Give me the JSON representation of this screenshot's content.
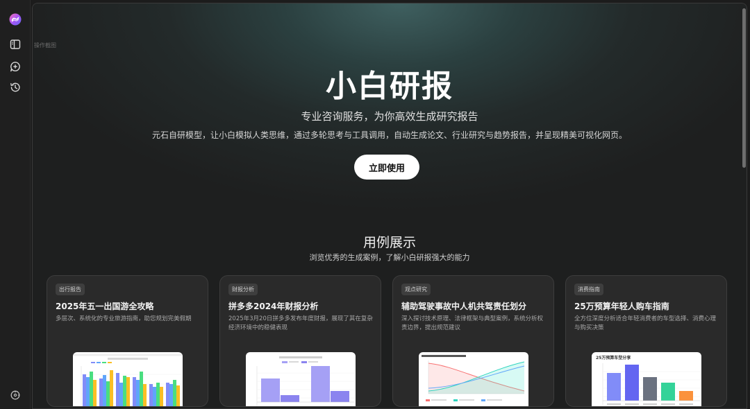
{
  "sidebar": {
    "logo": "logo-icon",
    "items": [
      {
        "icon": "sidebar-toggle-icon"
      },
      {
        "icon": "new-chat-icon"
      },
      {
        "icon": "history-icon"
      }
    ],
    "bottom_icon": "settings-icon"
  },
  "main": {
    "tiny_label": "操作截图",
    "hero": {
      "title": "小白研报",
      "subtitle": "专业咨询服务，为你高效生成研究报告",
      "description": "元石自研模型，让小白模拟人类思维，通过多轮思考与工具调用，自动生成论文、行业研究与趋势报告，并呈现精美可视化网页。",
      "cta": "立即使用"
    },
    "showcase": {
      "title": "用例展示",
      "subtitle": "浏览优秀的生成案例，了解小白研报强大的能力",
      "cards": [
        {
          "tag": "出行报告",
          "title": "2025年五一出国游全攻略",
          "desc": "多层次、系统化的专业旅游指南，助您规划完美假期"
        },
        {
          "tag": "财报分析",
          "title": "拼多多2024年财报分析",
          "desc": "2025年3月20日拼多多发布年度财报，展现了其在复杂经济环境中的稳健表现"
        },
        {
          "tag": "观点研究",
          "title": "辅助驾驶事故中人机共驾责任划分",
          "desc": "深入探讨技术原理、法律框架与典型案例，系统分析权责边界，提出规范建议"
        },
        {
          "tag": "消费指南",
          "title": "25万预算年轻人购车指南",
          "desc": "全方位深度分析适合年轻消费者的车型选择、消费心理与购买决策"
        }
      ],
      "thumb4_title": "25万预算车型分享"
    }
  },
  "colors": {
    "accent": "#8b5cf6",
    "card_bg": "#2a2a2a",
    "cta_bg": "#ffffff"
  }
}
